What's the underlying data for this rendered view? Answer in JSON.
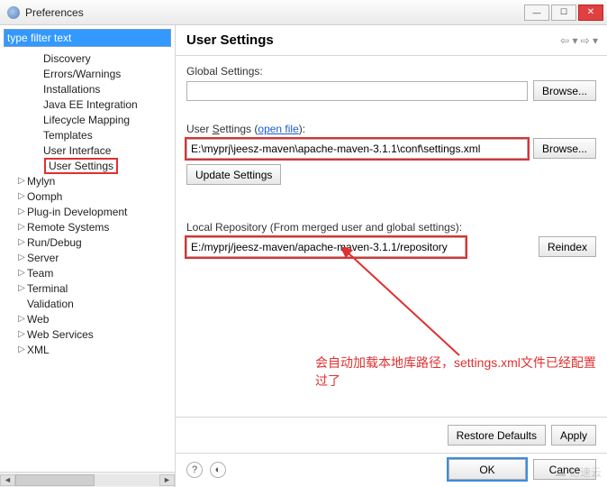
{
  "window": {
    "title": "Preferences"
  },
  "sidebar": {
    "filter_value": "type filter text",
    "sub_items": [
      "Discovery",
      "Errors/Warnings",
      "Installations",
      "Java EE Integration",
      "Lifecycle Mapping",
      "Templates",
      "User Interface",
      "User Settings"
    ],
    "top_items": [
      "Mylyn",
      "Oomph",
      "Plug-in Development",
      "Remote Systems",
      "Run/Debug",
      "Server",
      "Team",
      "Terminal",
      "Validation",
      "Web",
      "Web Services",
      "XML"
    ]
  },
  "main": {
    "heading": "User Settings",
    "global_label": "Global Settings:",
    "global_value": "",
    "browse1": "Browse...",
    "user_label_pre": "User ",
    "user_label_u": "S",
    "user_label_post": "ettings",
    "open_file": " (open file):",
    "open_file_link": "open file",
    "user_value": "E:\\myprj\\jeesz-maven\\apache-maven-3.1.1\\conf\\settings.xml",
    "browse2": "Browse...",
    "update": "Update Settings",
    "localrepo_label": "Local Repository (From merged user and global settings):",
    "localrepo_value": "E:/myprj/jeesz-maven/apache-maven-3.1.1/repository",
    "reindex": "Reindex",
    "annotation": "会自动加载本地库路径，settings.xml文件已经配置过了",
    "restore": "Restore Defaults",
    "apply": "Apply",
    "ok": "OK",
    "cancel": "Cance"
  },
  "watermark": "亿速云"
}
